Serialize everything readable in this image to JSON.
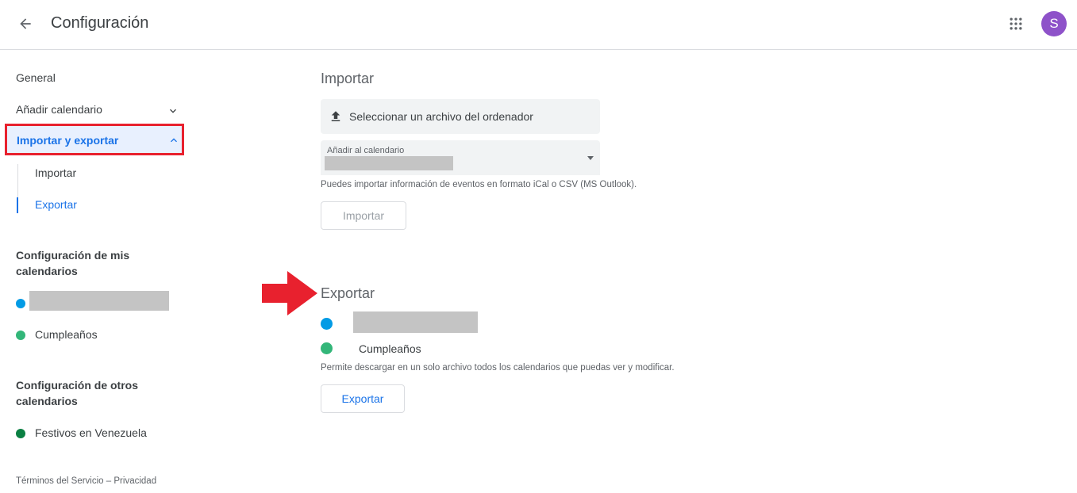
{
  "header": {
    "title": "Configuración",
    "avatar_letter": "S",
    "back_icon": "arrow-left-icon",
    "apps_icon": "apps-grid-icon"
  },
  "sidebar": {
    "general": "General",
    "add_calendar": "Añadir calendario",
    "import_export": "Importar y exportar",
    "sub_import": "Importar",
    "sub_export": "Exportar",
    "my_calendars_title": "Configuración de mis calendarios",
    "my_calendars": [
      {
        "label": "",
        "color": "#039be5",
        "redacted": true
      },
      {
        "label": "Cumpleaños",
        "color": "#33b679"
      }
    ],
    "other_calendars_title": "Configuración de otros calendarios",
    "other_calendars": [
      {
        "label": "Festivos en Venezuela",
        "color": "#0b8043"
      }
    ],
    "footer_terms": "Términos del Servicio",
    "footer_separator": "–",
    "footer_privacy": "Privacidad"
  },
  "import_section": {
    "title": "Importar",
    "file_select_label": "Seleccionar un archivo del ordenador",
    "calendar_select_label": "Añadir al calendario",
    "help": "Puedes importar información de eventos en formato iCal o CSV (MS Outlook).",
    "button": "Importar"
  },
  "export_section": {
    "title": "Exportar",
    "calendars": [
      {
        "label": "",
        "color": "#039be5",
        "redacted": true
      },
      {
        "label": "Cumpleaños",
        "color": "#33b679"
      }
    ],
    "help": "Permite descargar en un solo archivo todos los calendarios que puedas ver y modificar.",
    "button": "Exportar"
  },
  "colors": {
    "accent": "#1a73e8",
    "highlight_border": "#e8212e",
    "annotation_arrow": "#e8212e",
    "avatar_bg": "#8e52c9"
  }
}
